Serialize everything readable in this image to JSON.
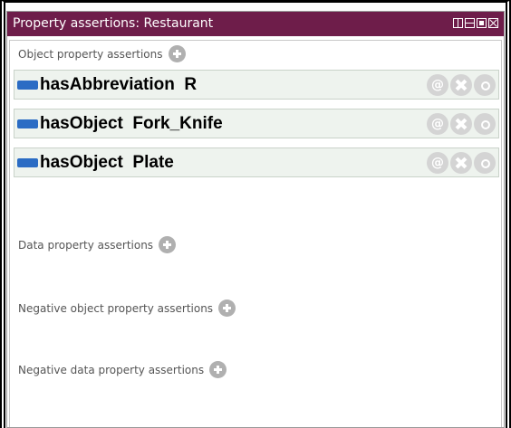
{
  "window": {
    "title": "Property assertions: Restaurant"
  },
  "sections": {
    "object_property": {
      "label": "Object property assertions"
    },
    "data_property": {
      "label": "Data property assertions"
    },
    "negative_object_property": {
      "label": "Negative object property assertions"
    },
    "negative_data_property": {
      "label": "Negative data property assertions"
    }
  },
  "assertions": [
    {
      "text": "hasAbbreviation  R"
    },
    {
      "text": "hasObject  Fork_Knife"
    },
    {
      "text": "hasObject  Plate"
    }
  ],
  "row_buttons": {
    "annotate_glyph": "@"
  },
  "colors": {
    "titlebar": "#6e1d4a",
    "object_property_icon": "#2b6cc4",
    "row_background": "#eef3ee"
  }
}
